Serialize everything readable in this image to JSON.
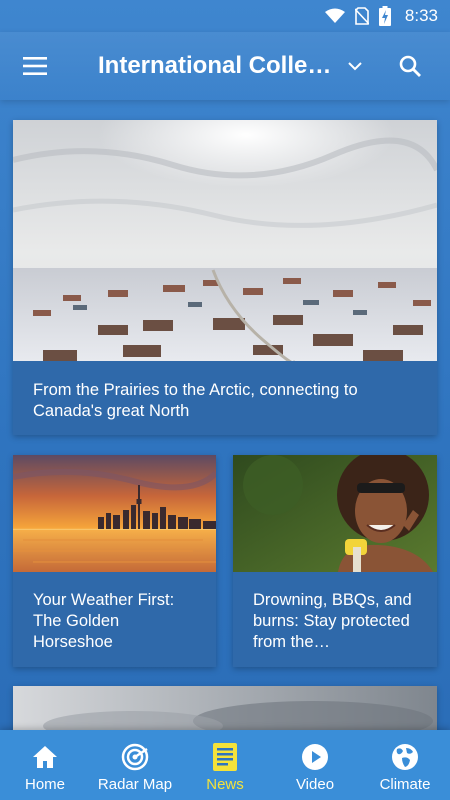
{
  "status_bar": {
    "time": "8:33"
  },
  "app_bar": {
    "title": "International Colleg…"
  },
  "articles": [
    {
      "title": "From the Prairies to the Arctic, connecting to Canada's great North"
    },
    {
      "title": "Your Weather First: The Golden Horseshoe"
    },
    {
      "title": "Drowning, BBQs, and burns: Stay protected from the…"
    }
  ],
  "bottom_nav": {
    "items": [
      {
        "label": "Home",
        "icon": "home-icon"
      },
      {
        "label": "Radar Map",
        "icon": "radar-icon"
      },
      {
        "label": "News",
        "icon": "news-icon",
        "active": true
      },
      {
        "label": "Video",
        "icon": "play-icon"
      },
      {
        "label": "Climate",
        "icon": "globe-icon"
      }
    ]
  },
  "colors": {
    "accent": "#f4e23a",
    "nav_bg": "#3a8ed8",
    "card_caption_bg": "#2f69aa"
  }
}
